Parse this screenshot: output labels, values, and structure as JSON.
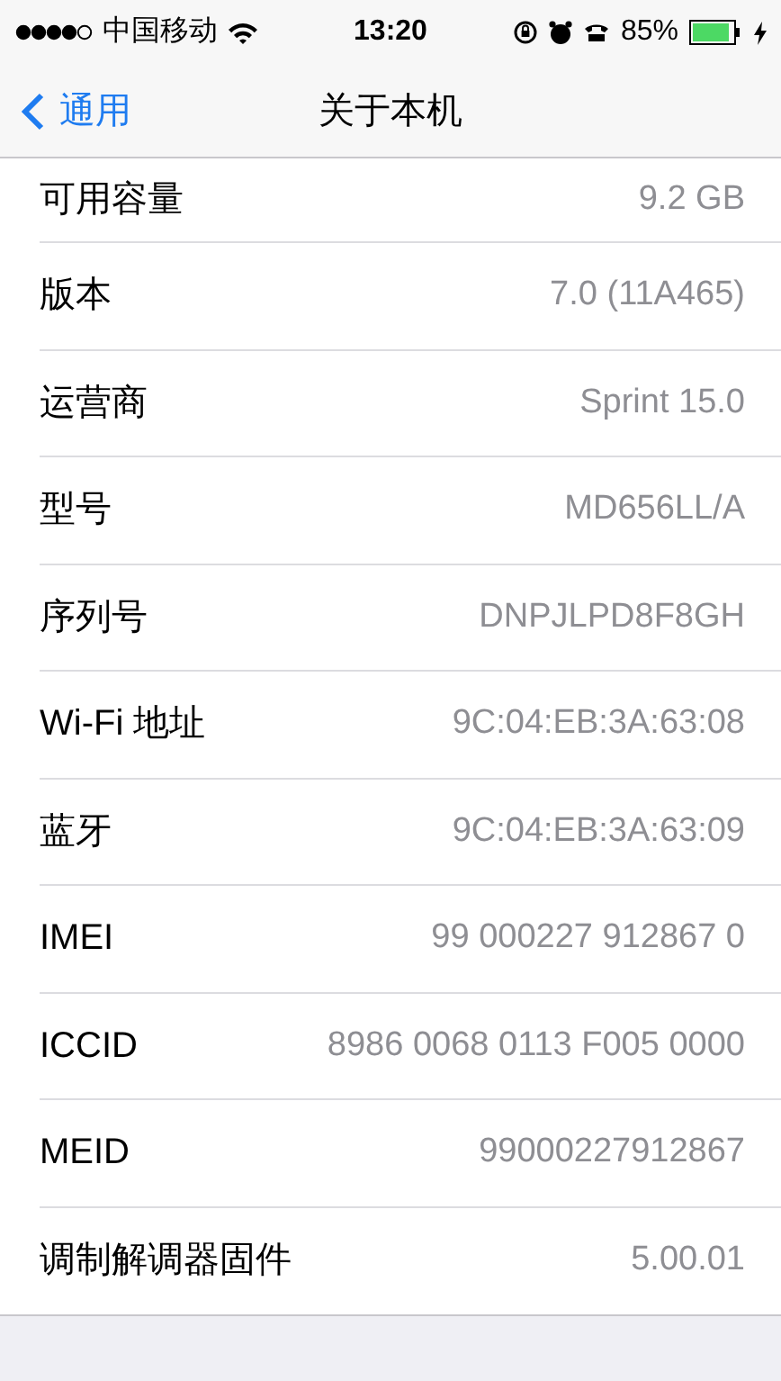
{
  "status_bar": {
    "carrier": "中国移动",
    "time": "13:20",
    "battery": "85%"
  },
  "nav": {
    "back": "通用",
    "title": "关于本机"
  },
  "rows": [
    {
      "label": "可用容量",
      "value": "9.2 GB"
    },
    {
      "label": "版本",
      "value": "7.0 (11A465)"
    },
    {
      "label": "运营商",
      "value": "Sprint 15.0"
    },
    {
      "label": "型号",
      "value": "MD656LL/A"
    },
    {
      "label": "序列号",
      "value": "DNPJLPD8F8GH"
    },
    {
      "label": "Wi-Fi 地址",
      "value": "9C:04:EB:3A:63:08"
    },
    {
      "label": "蓝牙",
      "value": "9C:04:EB:3A:63:09"
    },
    {
      "label": "IMEI",
      "value": "99 000227 912867 0"
    },
    {
      "label": "ICCID",
      "value": "8986 0068 0113 F005 0000"
    },
    {
      "label": "MEID",
      "value": "99000227912867"
    },
    {
      "label": "调制解调器固件",
      "value": "5.00.01"
    }
  ]
}
